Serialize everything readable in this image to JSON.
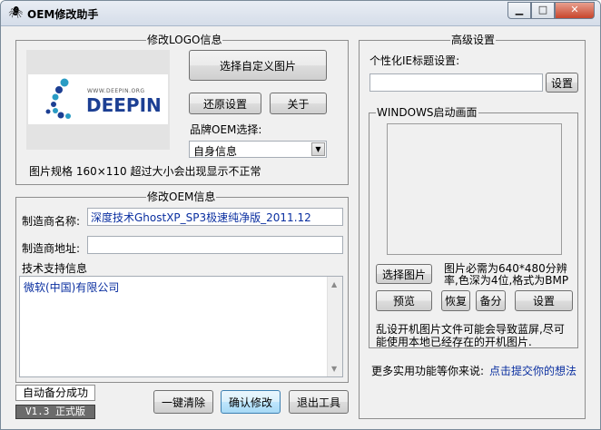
{
  "window": {
    "title": "OEM修改助手",
    "controls": {
      "minimize": "▁",
      "maximize": "□",
      "close": "✕"
    }
  },
  "logo_group": {
    "legend": "修改LOGO信息",
    "logo_site": "WWW.DEEPIN.ORG",
    "logo_brand": "DEEPIN",
    "choose_image_button": "选择自定义图片",
    "restore_button": "还原设置",
    "about_button": "关于",
    "brand_oem_label": "品牌OEM选择:",
    "brand_oem_value": "自身信息",
    "image_spec_note": "图片规格 160×110 超过大小会出现显示不正常"
  },
  "oem_group": {
    "legend": "修改OEM信息",
    "manufacturer_label": "制造商名称:",
    "manufacturer_value": "深度技术GhostXP_SP3极速纯净版_2011.12",
    "manufacturer_address_label": "制造商地址:",
    "manufacturer_address_value": "",
    "support_label": "技术支持信息",
    "support_value": "微软(中国)有限公司"
  },
  "advanced_group": {
    "legend": "高级设置",
    "ie_title_label": "个性化IE标题设置:",
    "ie_title_value": "",
    "ie_set_button": "设置",
    "boot_group": {
      "legend": "WINDOWS启动画面",
      "choose_image_button": "选择图片",
      "requirement_line1": "图片必需为640*480分辨",
      "requirement_line2": "率,色深为4位,格式为BMP",
      "preview_button": "预览",
      "restore_button": "恢复",
      "backup_button": "备分",
      "set_button": "设置",
      "warning_line1": "乱设开机图片文件可能会导致蓝屏,尽可",
      "warning_line2": "能使用本地已经存在的开机图片."
    },
    "more_text": "更多实用功能等你来说:",
    "feedback_link": "点击提交你的想法"
  },
  "footer": {
    "status": "自动备分成功",
    "version": "V1.3 正式版",
    "clear_button": "一键清除",
    "confirm_button": "确认修改",
    "exit_button": "退出工具"
  },
  "colors": {
    "accent_link": "#0a2fa0",
    "logo_blue": "#1c3f93",
    "logo_teal": "#2a9cc4"
  }
}
